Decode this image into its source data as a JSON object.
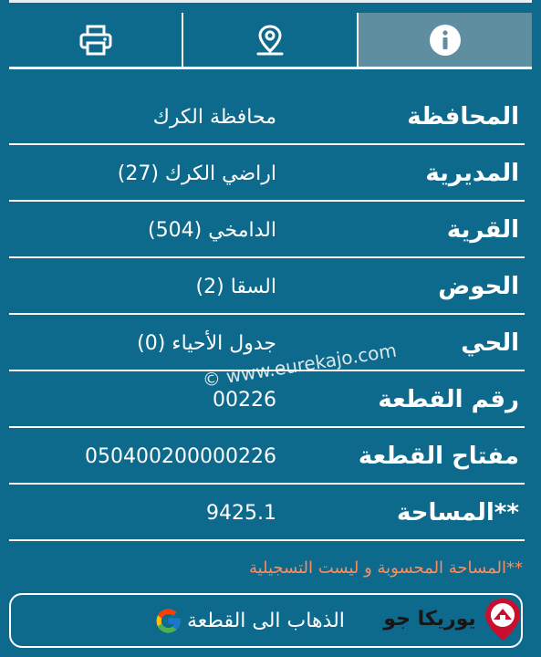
{
  "toolbar": {
    "tabs": [
      {
        "icon": "printer-icon"
      },
      {
        "icon": "map-pin-icon"
      },
      {
        "icon": "info-icon",
        "active": true
      }
    ]
  },
  "details": [
    {
      "label": "المحافظة",
      "value": "محافظة الكرك"
    },
    {
      "label": "المديرية",
      "value": "اراضي الكرك (27)"
    },
    {
      "label": "القرية",
      "value": "الدامخي (504)"
    },
    {
      "label": "الحوض",
      "value": "السقا (2)"
    },
    {
      "label": "الحي",
      "value": "جدول الأحياء (0)"
    },
    {
      "label": "رقم القطعة",
      "value": "00226"
    },
    {
      "label": "مفتاح القطعة",
      "value": "050400200000226"
    },
    {
      "label": "**المساحة",
      "value": "9425.1"
    }
  ],
  "watermark": "© www.eurekajo.com",
  "footnote": "**المساحة المحسوبة و ليست التسجيلية",
  "goto_button": {
    "label": "الذهاب الى القطعة",
    "icon": "google-icon"
  },
  "brand": {
    "name": "يوريكا جو",
    "icon": "eureka-logo-icon"
  },
  "colors": {
    "background": "#0e6a8c",
    "active_tab": "#5f8ea1",
    "note": "#ff8c5a",
    "text": "#ffffff"
  }
}
